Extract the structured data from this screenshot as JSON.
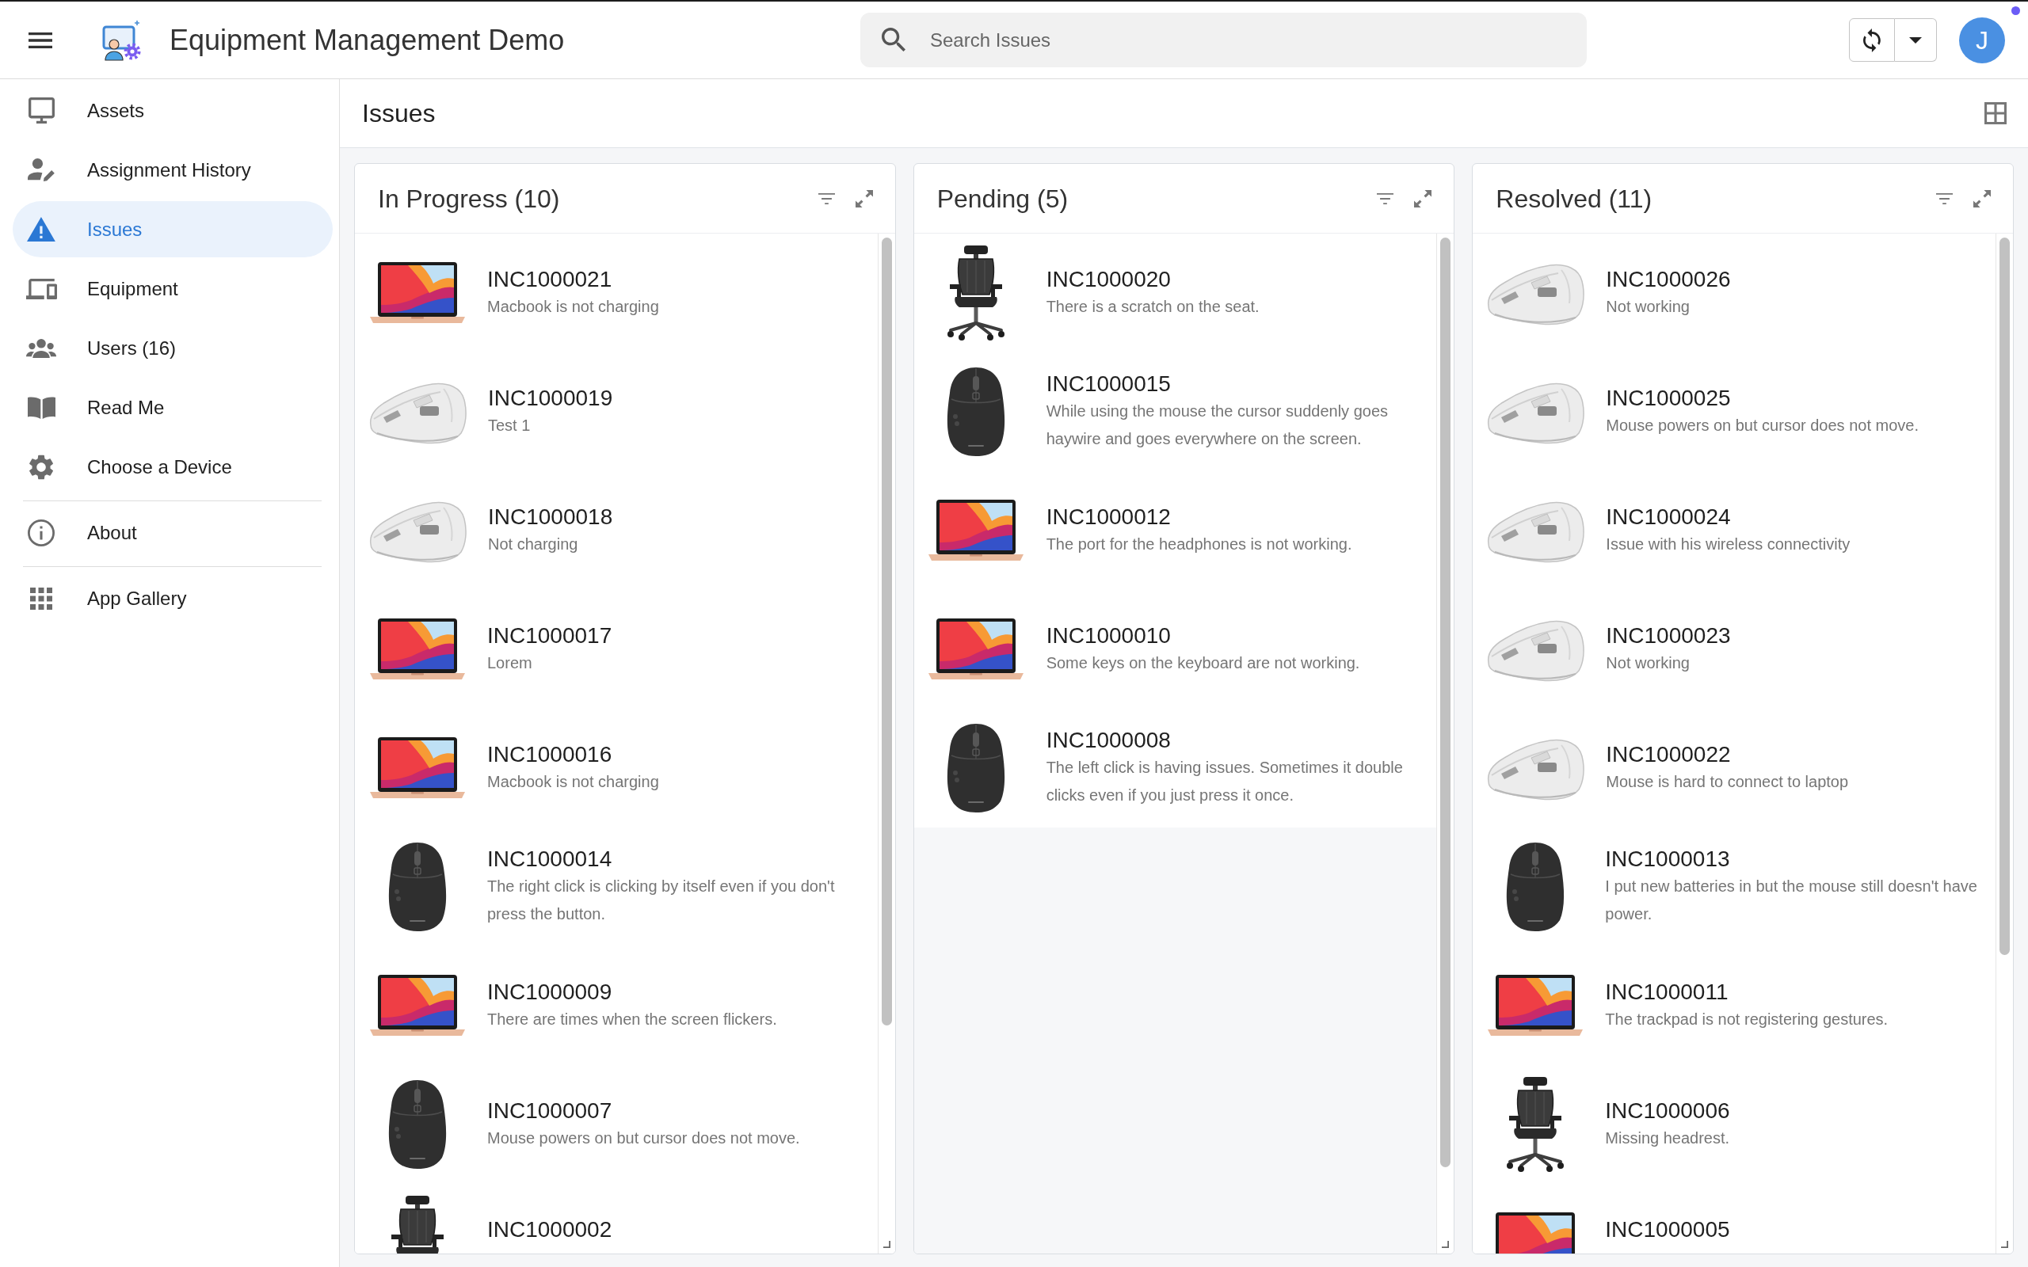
{
  "app_bar": {
    "title": "Equipment Management Demo",
    "search": {
      "placeholder": "Search Issues"
    },
    "avatar": {
      "initial": "J"
    }
  },
  "sidebar": {
    "sections": [
      {
        "items": [
          {
            "label": "Assets",
            "selected": false
          },
          {
            "label": "Assignment History",
            "selected": false
          },
          {
            "label": "Issues",
            "selected": true
          },
          {
            "label": "Equipment",
            "selected": false
          },
          {
            "label": "Users (16)",
            "selected": false
          },
          {
            "label": "Read Me",
            "selected": false
          },
          {
            "label": "Choose a Device",
            "selected": false
          }
        ]
      },
      {
        "items": [
          {
            "label": "About",
            "selected": false
          }
        ]
      },
      {
        "items": [
          {
            "label": "App Gallery",
            "selected": false
          }
        ]
      }
    ]
  },
  "page": {
    "title": "Issues"
  },
  "columns": [
    {
      "title": "In Progress (10)",
      "items": [
        {
          "number": "INC1000021",
          "description": "Macbook is not charging",
          "kind": "laptop"
        },
        {
          "number": "INC1000019",
          "description": "Test 1",
          "kind": "mouse_light"
        },
        {
          "number": "INC1000018",
          "description": "Not charging",
          "kind": "mouse_light"
        },
        {
          "number": "INC1000017",
          "description": "Lorem",
          "kind": "laptop"
        },
        {
          "number": "INC1000016",
          "description": "Macbook is not charging",
          "kind": "laptop"
        },
        {
          "number": "INC1000014",
          "description": "The right click is clicking by itself even if you don't press the button.",
          "kind": "mouse_dark"
        },
        {
          "number": "INC1000009",
          "description": "There are times when the screen flickers.",
          "kind": "laptop"
        },
        {
          "number": "INC1000007",
          "description": "Mouse powers on but cursor does not move.",
          "kind": "mouse_dark"
        },
        {
          "number": "INC1000002",
          "kind": "chair"
        }
      ]
    },
    {
      "title": "Pending (5)",
      "items": [
        {
          "number": "INC1000020",
          "description": "There is a scratch on the seat.",
          "kind": "chair"
        },
        {
          "number": "INC1000015",
          "description": "While using the mouse the cursor suddenly goes haywire and goes everywhere on the screen.",
          "kind": "mouse_dark"
        },
        {
          "number": "INC1000012",
          "description": "The port for the headphones is not working.",
          "kind": "laptop"
        },
        {
          "number": "INC1000010",
          "description": "Some keys on the keyboard are not working.",
          "kind": "laptop"
        },
        {
          "number": "INC1000008",
          "description": "The left click is having issues. Sometimes it double clicks even if you just press it once.",
          "kind": "mouse_dark"
        }
      ]
    },
    {
      "title": "Resolved (11)",
      "items": [
        {
          "number": "INC1000026",
          "description": "Not working",
          "kind": "mouse_light"
        },
        {
          "number": "INC1000025",
          "description": "Mouse powers on but cursor does not move.",
          "kind": "mouse_light"
        },
        {
          "number": "INC1000024",
          "description": "Issue with his wireless connectivity",
          "kind": "mouse_light"
        },
        {
          "number": "INC1000023",
          "description": "Not working",
          "kind": "mouse_light"
        },
        {
          "number": "INC1000022",
          "description": "Mouse is hard to connect to laptop",
          "kind": "mouse_light"
        },
        {
          "number": "INC1000013",
          "description": "I put new batteries in but the mouse still doesn't have power.",
          "kind": "mouse_dark"
        },
        {
          "number": "INC1000011",
          "description": "The trackpad is not registering gestures.",
          "kind": "laptop"
        },
        {
          "number": "INC1000006",
          "description": "Missing headrest.",
          "kind": "chair"
        },
        {
          "number": "INC1000005",
          "kind": "laptop"
        }
      ]
    }
  ]
}
